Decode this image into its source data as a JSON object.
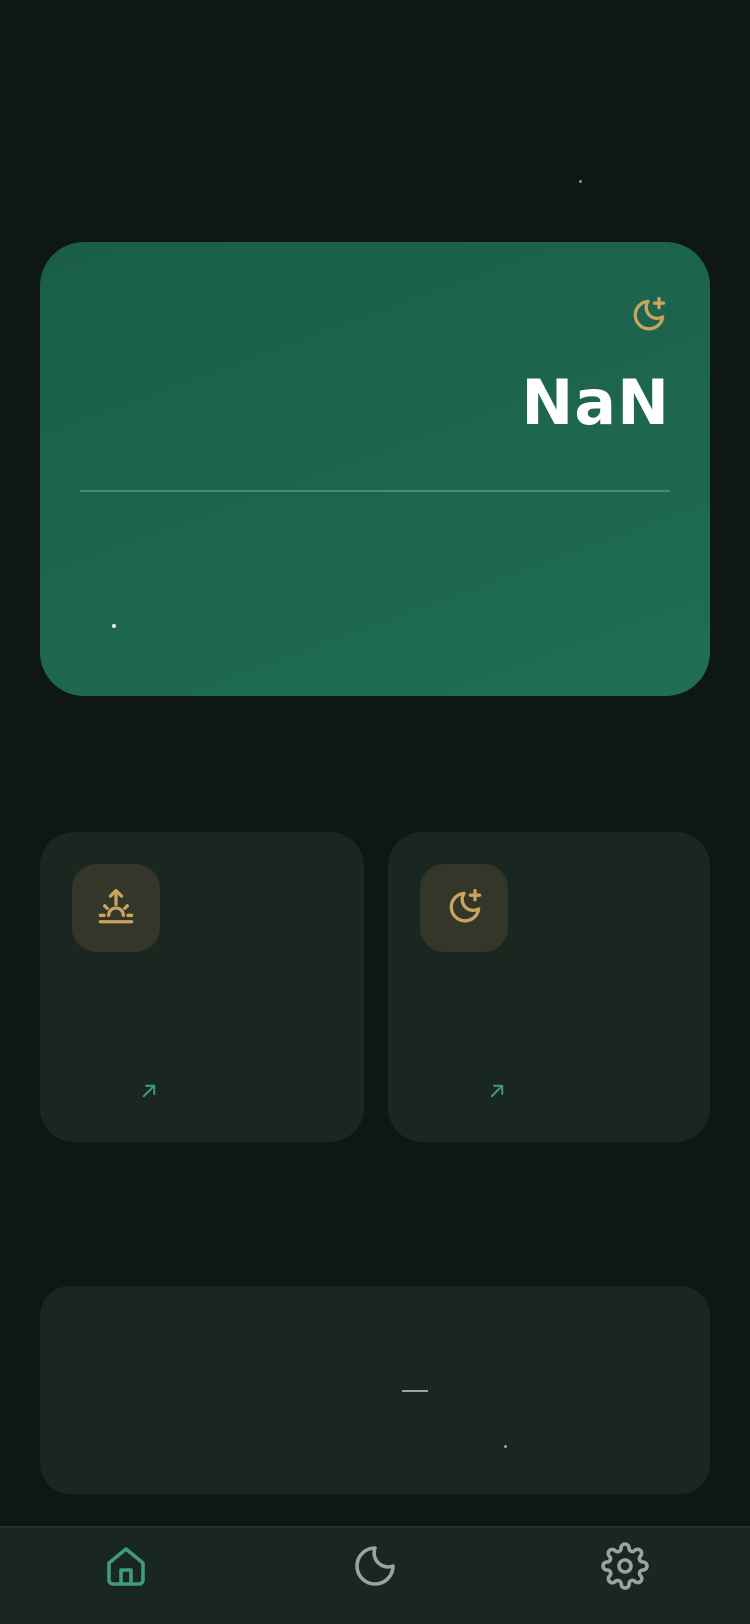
{
  "colors": {
    "background": "#0f1713",
    "hero_card": "#1d654e",
    "tile": "#1a2620",
    "accent_gold": "#c9a45c",
    "accent_green": "#3f9b7a",
    "nav_active": "#3f9b7a",
    "nav_inactive": "#9aa39d"
  },
  "hero": {
    "icon": "moon-plus-icon",
    "value": "NaN"
  },
  "tiles": [
    {
      "icon": "sunrise-icon",
      "arrow_icon": "arrow-up-right-icon"
    },
    {
      "icon": "moon-plus-icon",
      "arrow_icon": "arrow-up-right-icon"
    }
  ],
  "nav": {
    "items": [
      {
        "icon": "home-icon",
        "active": true
      },
      {
        "icon": "moon-icon",
        "active": false
      },
      {
        "icon": "gear-icon",
        "active": false
      }
    ]
  }
}
